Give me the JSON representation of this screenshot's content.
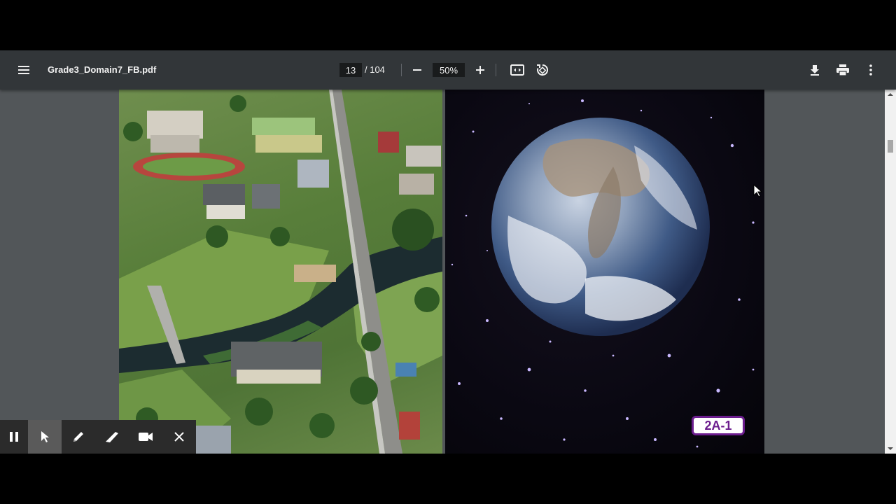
{
  "toolbar": {
    "file_name": "Grade3_Domain7_FB.pdf",
    "current_page": "13",
    "total_pages": "/ 104",
    "zoom": "50%"
  },
  "right_page": {
    "badge_label": "2A-1"
  },
  "icons": {
    "menu": "hamburger-icon",
    "zoom_out": "minus-icon",
    "zoom_in": "plus-icon",
    "fit": "fit-page-icon",
    "rotate": "rotate-icon",
    "download": "download-icon",
    "print": "print-icon",
    "more": "more-vert-icon",
    "pause": "pause-icon",
    "pointer": "cursor-icon",
    "pen": "pen-icon",
    "highlighter": "highlighter-icon",
    "camera": "video-camera-icon",
    "close": "close-icon"
  },
  "colors": {
    "toolbar_bg": "#323639",
    "viewer_bg": "#525659",
    "badge_accent": "#6c1d8e"
  }
}
